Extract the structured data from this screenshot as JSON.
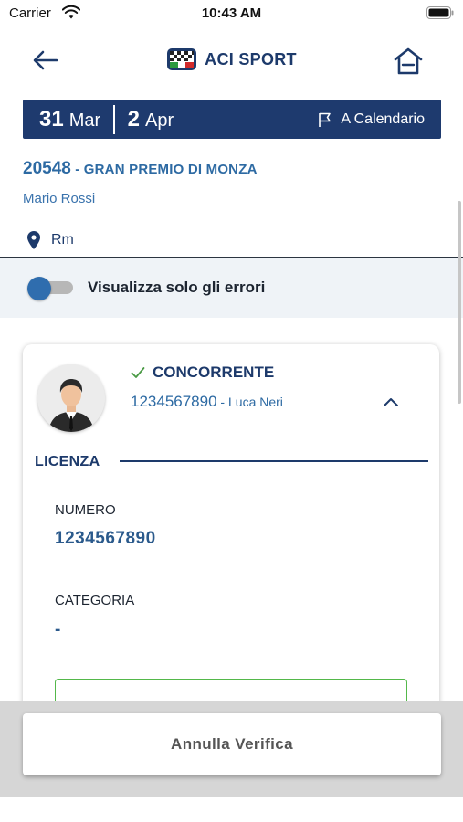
{
  "status_bar": {
    "carrier": "Carrier",
    "time": "10:43 AM"
  },
  "header": {
    "title": "ACI SPORT",
    "back_icon": "arrow-left-icon",
    "home_icon": "home-icon"
  },
  "date_bar": {
    "start_day": "31",
    "start_month": "Mar",
    "end_day": "2",
    "end_month": "Apr",
    "calendar_label": "A Calendario"
  },
  "event": {
    "code": "20548",
    "separator": " - ",
    "name": "GRAN PREMIO DI MONZA",
    "person": "Mario Rossi",
    "location": "Rm"
  },
  "filter": {
    "label": "Visualizza solo gli errori",
    "enabled": false
  },
  "card": {
    "role": "CONCORRENTE",
    "number": "1234567890",
    "name_separator": " - ",
    "name": "Luca Neri",
    "section_title": "LICENZA",
    "fields": [
      {
        "label": "NUMERO",
        "value": "1234567890"
      },
      {
        "label": "CATEGORIA",
        "value": "-"
      }
    ]
  },
  "footer": {
    "cancel_label": "Annulla Verifica"
  },
  "colors": {
    "primary": "#1e3a6e",
    "accent_blue": "#2d6aa3",
    "success_green": "#53b84a"
  }
}
